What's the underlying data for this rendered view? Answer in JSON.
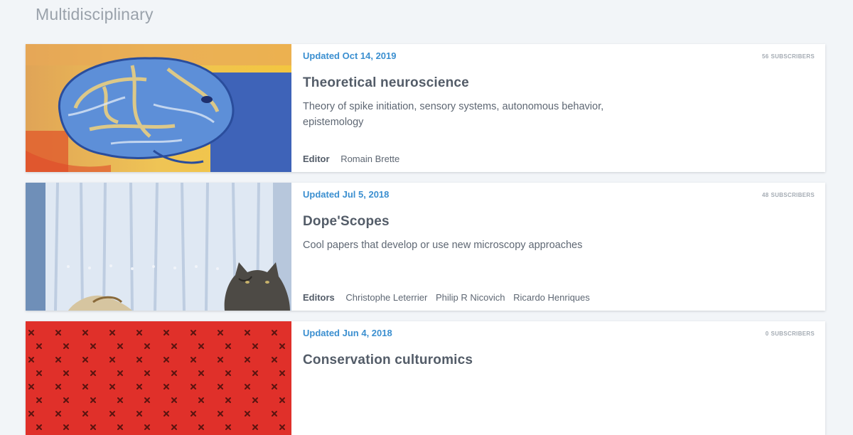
{
  "page": {
    "section_title": "Multidisciplinary"
  },
  "collections": [
    {
      "updated": "Updated Oct 14, 2019",
      "subscribers_count": "56",
      "subscribers_label": "SUBSCRIBERS",
      "title": "Theoretical neuroscience",
      "description": "Theory of spike initiation, sensory systems, autonomous behavior, epistemology",
      "editors_label": "Editor",
      "editors": [
        "Romain Brette"
      ],
      "image": "brain-painting"
    },
    {
      "updated": "Updated Jul 5, 2018",
      "subscribers_count": "48",
      "subscribers_label": "SUBSCRIBERS",
      "title": "Dope'Scopes",
      "description": "Cool papers that develop or use new microscopy approaches",
      "editors_label": "Editors",
      "editors": [
        "Christophe Leterrier",
        "Philip R Nicovich",
        "Ricardo Henriques"
      ],
      "image": "cat-by-window-photo"
    },
    {
      "updated": "Updated Jun 4, 2018",
      "subscribers_count": "0",
      "subscribers_label": "SUBSCRIBERS",
      "title": "Conservation culturomics",
      "description": "",
      "editors_label": "",
      "editors": [],
      "image": "red-cross-pattern"
    }
  ],
  "colors": {
    "page_background": "#f2f5f8",
    "accent_link": "#3b8fd0",
    "title_text": "#535c68",
    "muted_text": "#a4abb3",
    "pattern_red": "#e0302a"
  }
}
